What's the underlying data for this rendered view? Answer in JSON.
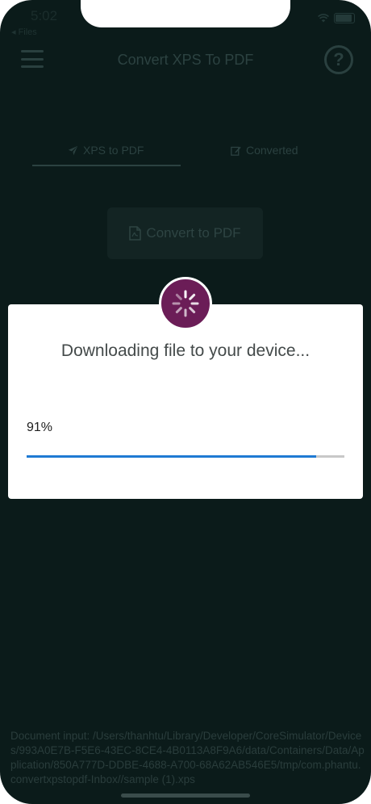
{
  "status_bar": {
    "time": "5:02",
    "back_app": "◂ Files"
  },
  "nav": {
    "title": "Convert XPS To PDF",
    "help_glyph": "?"
  },
  "tabs": [
    {
      "label": "XPS to PDF",
      "icon": "paper-plane-icon",
      "active": true
    },
    {
      "label": "Converted",
      "icon": "edit-icon",
      "active": false
    }
  ],
  "convert_button": {
    "label": "Convert to PDF",
    "icon": "file-pdf-icon"
  },
  "dialog": {
    "message": "Downloading file to your device...",
    "progress_text": "91%",
    "progress_value": 0.91,
    "accent_color": "#1f7ad3",
    "spinner_color": "#6b1d57"
  },
  "footer": {
    "document_input": "Document input: /Users/thanhtu/Library/Developer/CoreSimulator/Devices/993A0E7B-F5E6-43EC-8CE4-4B0113A8F9A6/data/Containers/Data/Application/850A777D-DDBE-4688-A700-68A62AB546E5/tmp/com.phantu.convertxpstopdf-Inbox//sample (1).xps"
  }
}
